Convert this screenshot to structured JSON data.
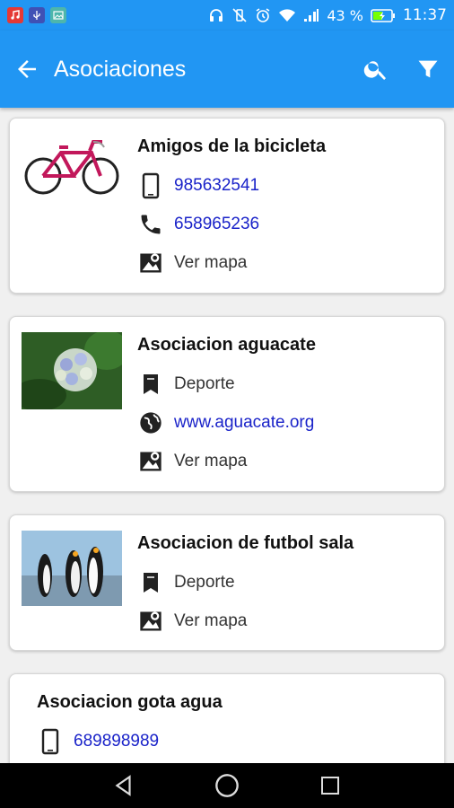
{
  "status": {
    "battery_percent": "43 %",
    "time": "11:37"
  },
  "appbar": {
    "title": "Asociaciones"
  },
  "cards": [
    {
      "name": "Amigos de la bicicleta",
      "mobile": "985632541",
      "phone": "658965236",
      "map_label": "Ver mapa"
    },
    {
      "name": "Asociacion aguacate",
      "category": "Deporte",
      "website": "www.aguacate.org",
      "map_label": "Ver mapa"
    },
    {
      "name": "Asociacion de futbol sala",
      "category": "Deporte",
      "map_label": "Ver mapa"
    },
    {
      "name": "Asociacion gota agua",
      "mobile": "689898989"
    }
  ],
  "colors": {
    "primary": "#2196f3",
    "link": "#1a23c9"
  }
}
